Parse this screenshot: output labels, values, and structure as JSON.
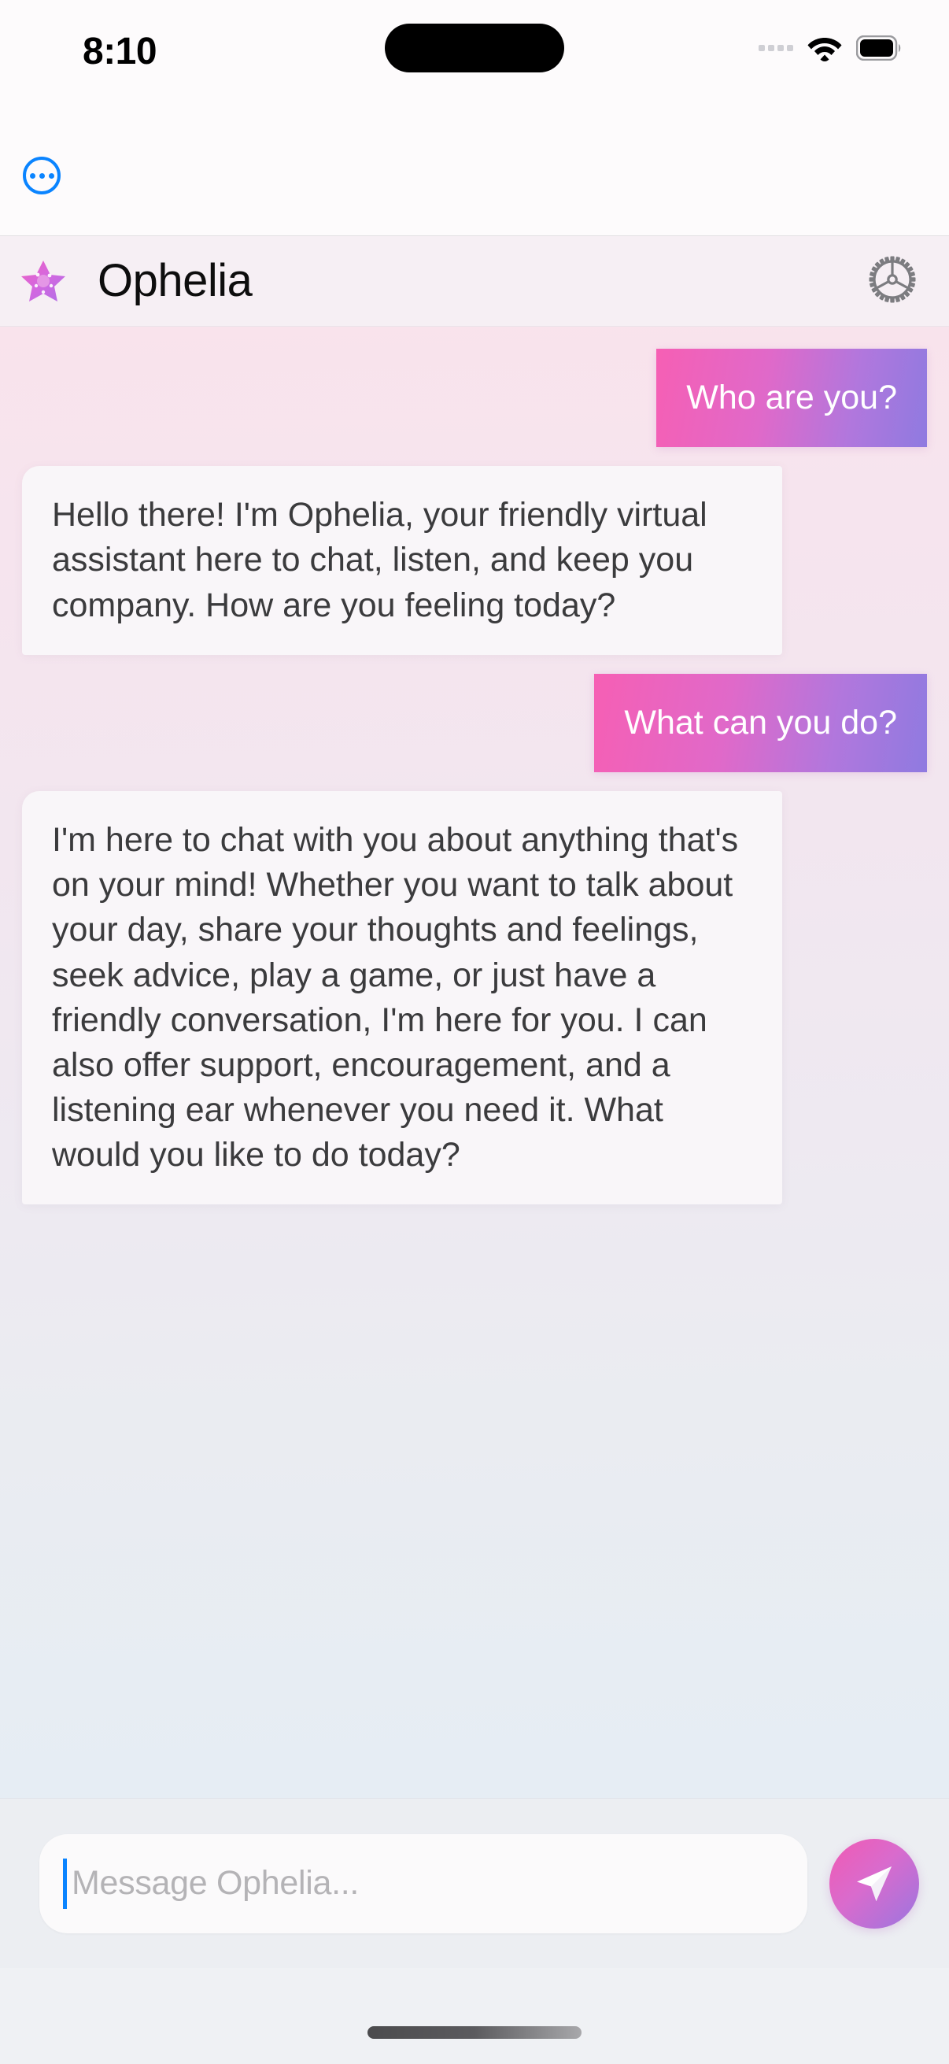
{
  "status_bar": {
    "time": "8:10",
    "cellular_icon": "cellular-dots-icon",
    "wifi_icon": "wifi-icon",
    "battery_icon": "battery-full-icon",
    "dynamic_island": "dynamic-island"
  },
  "nav": {
    "more_button_label": "•••",
    "more_button_icon": "ellipsis-circle-icon",
    "more_button_color": "#0a84ff"
  },
  "header": {
    "avatar_icon": "pink-star-icon",
    "title": "Ophelia",
    "settings_icon": "gear-icon",
    "background_color": "#f6eff4"
  },
  "chat": {
    "background_gradient_from": "#f9e3ec",
    "background_gradient_to": "#e6edf4",
    "user_bubble_gradient_from": "#f65fb4",
    "user_bubble_gradient_to": "#8f7ae0",
    "bot_bubble_color": "#f9f6f9",
    "messages": [
      {
        "role": "user",
        "text": "Who are you?"
      },
      {
        "role": "bot",
        "text": "Hello there! I'm Ophelia, your friendly virtual assistant here to chat, listen, and keep you company. How are you feeling today?"
      },
      {
        "role": "user",
        "text": "What can you do?"
      },
      {
        "role": "bot",
        "text": "I'm here to chat with you about anything that's on your mind! Whether you want to talk about your day, share your thoughts and feelings, seek advice, play a game, or just have a friendly conversation, I'm here for you. I can also offer support, encouragement, and a listening ear whenever you need it. What would you like to do today?"
      }
    ]
  },
  "input_bar": {
    "placeholder": "Message Ophelia...",
    "value": "",
    "caret_color": "#0a84ff",
    "send_icon": "send-paper-plane-icon"
  },
  "home_indicator": {
    "label": "home-indicator"
  }
}
